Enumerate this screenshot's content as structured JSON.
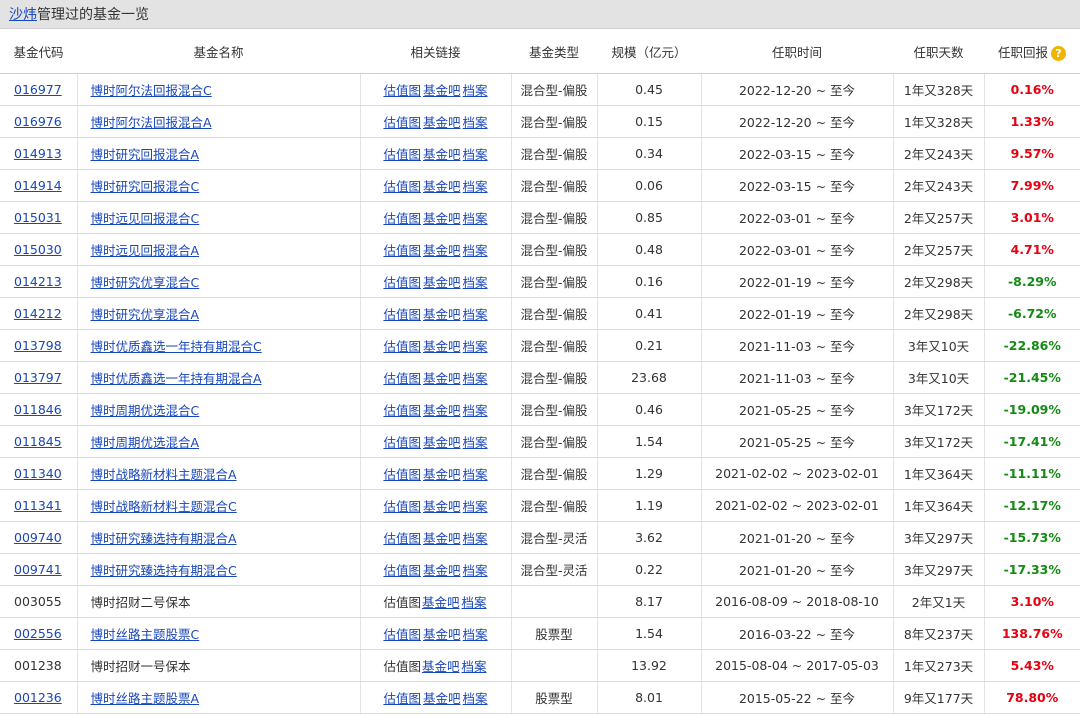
{
  "title": {
    "manager": "沙炜",
    "suffix": "管理过的基金一览"
  },
  "headers": [
    "基金代码",
    "基金名称",
    "相关链接",
    "基金类型",
    "规模（亿元）",
    "任职时间",
    "任职天数",
    "任职回报"
  ],
  "link_labels": [
    "估值图",
    "基金吧",
    "档案"
  ],
  "colors": {
    "positive": "#e60012",
    "negative": "#138a13",
    "link": "#1a47b8"
  },
  "rows": [
    {
      "code": "016977",
      "name": "博时阿尔法回报混合C",
      "type": "混合型-偏股",
      "size": "0.45",
      "period": "2022-12-20 ~ 至今",
      "days": "1年又328天",
      "return": "0.16%",
      "linked": true
    },
    {
      "code": "016976",
      "name": "博时阿尔法回报混合A",
      "type": "混合型-偏股",
      "size": "0.15",
      "period": "2022-12-20 ~ 至今",
      "days": "1年又328天",
      "return": "1.33%",
      "linked": true
    },
    {
      "code": "014913",
      "name": "博时研究回报混合A",
      "type": "混合型-偏股",
      "size": "0.34",
      "period": "2022-03-15 ~ 至今",
      "days": "2年又243天",
      "return": "9.57%",
      "linked": true
    },
    {
      "code": "014914",
      "name": "博时研究回报混合C",
      "type": "混合型-偏股",
      "size": "0.06",
      "period": "2022-03-15 ~ 至今",
      "days": "2年又243天",
      "return": "7.99%",
      "linked": true
    },
    {
      "code": "015031",
      "name": "博时远见回报混合C",
      "type": "混合型-偏股",
      "size": "0.85",
      "period": "2022-03-01 ~ 至今",
      "days": "2年又257天",
      "return": "3.01%",
      "linked": true
    },
    {
      "code": "015030",
      "name": "博时远见回报混合A",
      "type": "混合型-偏股",
      "size": "0.48",
      "period": "2022-03-01 ~ 至今",
      "days": "2年又257天",
      "return": "4.71%",
      "linked": true
    },
    {
      "code": "014213",
      "name": "博时研究优享混合C",
      "type": "混合型-偏股",
      "size": "0.16",
      "period": "2022-01-19 ~ 至今",
      "days": "2年又298天",
      "return": "-8.29%",
      "linked": true
    },
    {
      "code": "014212",
      "name": "博时研究优享混合A",
      "type": "混合型-偏股",
      "size": "0.41",
      "period": "2022-01-19 ~ 至今",
      "days": "2年又298天",
      "return": "-6.72%",
      "linked": true
    },
    {
      "code": "013798",
      "name": "博时优质鑫选一年持有期混合C",
      "type": "混合型-偏股",
      "size": "0.21",
      "period": "2021-11-03 ~ 至今",
      "days": "3年又10天",
      "return": "-22.86%",
      "linked": true
    },
    {
      "code": "013797",
      "name": "博时优质鑫选一年持有期混合A",
      "type": "混合型-偏股",
      "size": "23.68",
      "period": "2021-11-03 ~ 至今",
      "days": "3年又10天",
      "return": "-21.45%",
      "linked": true
    },
    {
      "code": "011846",
      "name": "博时周期优选混合C",
      "type": "混合型-偏股",
      "size": "0.46",
      "period": "2021-05-25 ~ 至今",
      "days": "3年又172天",
      "return": "-19.09%",
      "linked": true
    },
    {
      "code": "011845",
      "name": "博时周期优选混合A",
      "type": "混合型-偏股",
      "size": "1.54",
      "period": "2021-05-25 ~ 至今",
      "days": "3年又172天",
      "return": "-17.41%",
      "linked": true
    },
    {
      "code": "011340",
      "name": "博时战略新材料主题混合A",
      "type": "混合型-偏股",
      "size": "1.29",
      "period": "2021-02-02 ~ 2023-02-01",
      "days": "1年又364天",
      "return": "-11.11%",
      "linked": true
    },
    {
      "code": "011341",
      "name": "博时战略新材料主题混合C",
      "type": "混合型-偏股",
      "size": "1.19",
      "period": "2021-02-02 ~ 2023-02-01",
      "days": "1年又364天",
      "return": "-12.17%",
      "linked": true
    },
    {
      "code": "009740",
      "name": "博时研究臻选持有期混合A",
      "type": "混合型-灵活",
      "size": "3.62",
      "period": "2021-01-20 ~ 至今",
      "days": "3年又297天",
      "return": "-15.73%",
      "linked": true
    },
    {
      "code": "009741",
      "name": "博时研究臻选持有期混合C",
      "type": "混合型-灵活",
      "size": "0.22",
      "period": "2021-01-20 ~ 至今",
      "days": "3年又297天",
      "return": "-17.33%",
      "linked": true
    },
    {
      "code": "003055",
      "name": "博时招财二号保本",
      "type": "",
      "size": "8.17",
      "period": "2016-08-09 ~ 2018-08-10",
      "days": "2年又1天",
      "return": "3.10%",
      "linked": false
    },
    {
      "code": "002556",
      "name": "博时丝路主题股票C",
      "type": "股票型",
      "size": "1.54",
      "period": "2016-03-22 ~ 至今",
      "days": "8年又237天",
      "return": "138.76%",
      "linked": true
    },
    {
      "code": "001238",
      "name": "博时招财一号保本",
      "type": "",
      "size": "13.92",
      "period": "2015-08-04 ~ 2017-05-03",
      "days": "1年又273天",
      "return": "5.43%",
      "linked": false
    },
    {
      "code": "001236",
      "name": "博时丝路主题股票A",
      "type": "股票型",
      "size": "8.01",
      "period": "2015-05-22 ~ 至今",
      "days": "9年又177天",
      "return": "78.80%",
      "linked": true
    }
  ]
}
